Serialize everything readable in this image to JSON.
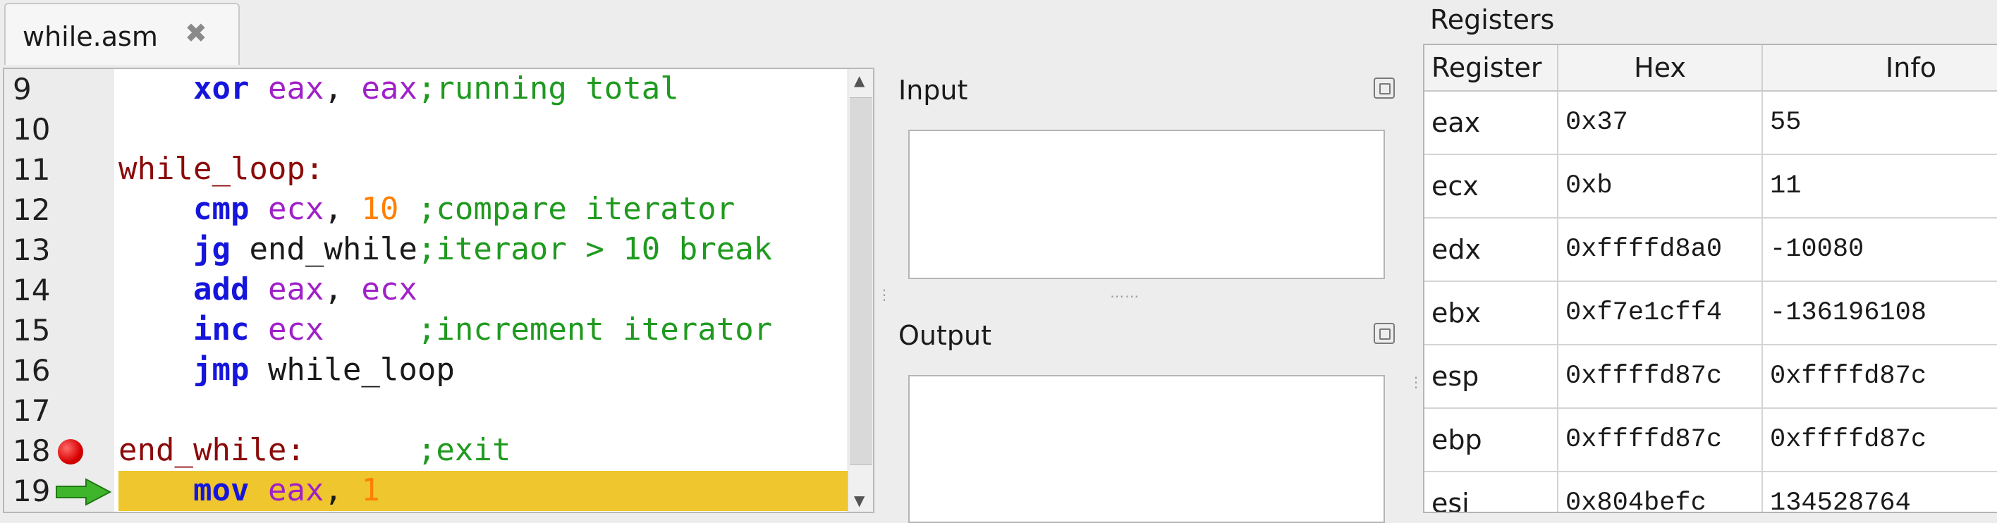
{
  "tab": {
    "title": "while.asm",
    "close_icon": "close-icon"
  },
  "editor": {
    "lines": [
      {
        "num": "9"
      },
      {
        "num": "10"
      },
      {
        "num": "11"
      },
      {
        "num": "12"
      },
      {
        "num": "13"
      },
      {
        "num": "14"
      },
      {
        "num": "15"
      },
      {
        "num": "16"
      },
      {
        "num": "17"
      },
      {
        "num": "18"
      },
      {
        "num": "19"
      }
    ],
    "code": {
      "l9": {
        "kw": "xor",
        "r1": "eax",
        "sep": ", ",
        "r2": "eax",
        "cmt": ";running total"
      },
      "l11": {
        "lbl": "while_loop:"
      },
      "l12": {
        "kw": "cmp",
        "r1": "ecx",
        "sep": ", ",
        "num": "10",
        "cmt": ";compare iterator"
      },
      "l13": {
        "kw": "jg",
        "txt": " end_while",
        "cmt": ";iteraor > 10 break"
      },
      "l14": {
        "kw": "add",
        "r1": "eax",
        "sep": ", ",
        "r2": "ecx"
      },
      "l15": {
        "kw": "inc",
        "r1": "ecx",
        "cmt": ";increment iterator"
      },
      "l16": {
        "kw": "jmp",
        "txt": " while_loop"
      },
      "l18": {
        "lbl": "end_while:",
        "cmt": ";exit"
      },
      "l19": {
        "kw": "mov",
        "r1": "eax",
        "sep": ", ",
        "num": "1"
      }
    },
    "breakpoint_line": "18",
    "current_line": "19",
    "colors": {
      "keyword": "#1515dc",
      "register": "#a020c8",
      "number": "#ff8000",
      "comment": "#1f9a1f",
      "label": "#8b0a0a",
      "current_line_bg": "#efc62d"
    }
  },
  "io": {
    "input_title": "Input",
    "output_title": "Output"
  },
  "registers": {
    "title": "Registers",
    "columns": [
      "Register",
      "Hex",
      "Info"
    ],
    "rows": [
      {
        "name": "eax",
        "hex": "0x37",
        "info": "55"
      },
      {
        "name": "ecx",
        "hex": "0xb",
        "info": "11"
      },
      {
        "name": "edx",
        "hex": "0xffffd8a0",
        "info": "-10080"
      },
      {
        "name": "ebx",
        "hex": "0xf7e1cff4",
        "info": "-136196108"
      },
      {
        "name": "esp",
        "hex": "0xffffd87c",
        "info": "0xffffd87c"
      },
      {
        "name": "ebp",
        "hex": "0xffffd87c",
        "info": "0xffffd87c"
      },
      {
        "name": "esi",
        "hex": "0x804befc",
        "info": "134528764"
      }
    ]
  }
}
